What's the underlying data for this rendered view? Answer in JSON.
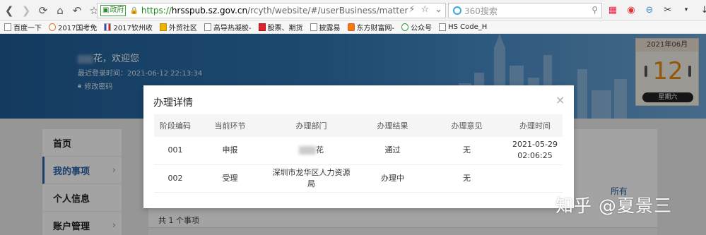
{
  "browser": {
    "gov_badge": "政府",
    "url_proto": "https://",
    "url_host": "hrsspub.sz.gov.cn",
    "url_path": "/rcyth/website/#/userBusiness/matter",
    "search_placeholder": "360搜索"
  },
  "bookmarks": [
    {
      "label": "百度一下",
      "icon": "page-icon"
    },
    {
      "label": "2017国考免",
      "icon": "circle-icon"
    },
    {
      "label": "2017钦州收",
      "icon": "flag-icon"
    },
    {
      "label": "外贸社区",
      "icon": "yellow-icon"
    },
    {
      "label": "高导热凝胶-",
      "icon": "page-icon"
    },
    {
      "label": "股票、期货",
      "icon": "red-icon"
    },
    {
      "label": "披露易",
      "icon": "page-icon"
    },
    {
      "label": "东方财富网-",
      "icon": "orange-icon"
    },
    {
      "label": "公众号",
      "icon": "green-icon"
    },
    {
      "label": "HS Code_H",
      "icon": "page-icon"
    }
  ],
  "header": {
    "welcome": "花，欢迎您",
    "last_login_label": "最近登录时间：",
    "last_login_time": "2021-06-12 22:13:34",
    "change_password": "修改密码"
  },
  "calendar": {
    "month": "2021年06月",
    "day": "12",
    "weekday": "星期六"
  },
  "sidebar": [
    {
      "label": "首页"
    },
    {
      "label": "我的事项",
      "active": true
    },
    {
      "label": "个人信息"
    },
    {
      "label": "账户管理"
    }
  ],
  "main": {
    "tab_all": "所有",
    "total": "共 1 个事项"
  },
  "modal": {
    "title": "办理详情",
    "close": "×",
    "columns": [
      "阶段编码",
      "当前环节",
      "办理部门",
      "办理结果",
      "办理意见",
      "办理时间"
    ],
    "rows": [
      {
        "code": "001",
        "step": "申报",
        "dept": "花",
        "result": "通过",
        "opinion": "无",
        "time_date": "2021-05-29",
        "time_clock": "02:06:25"
      },
      {
        "code": "002",
        "step": "受理",
        "dept_line1": "深圳市龙华区人力资源",
        "dept_line2": "局",
        "result": "办理中",
        "opinion": "无"
      }
    ]
  },
  "watermark": "知乎 @夏景三"
}
